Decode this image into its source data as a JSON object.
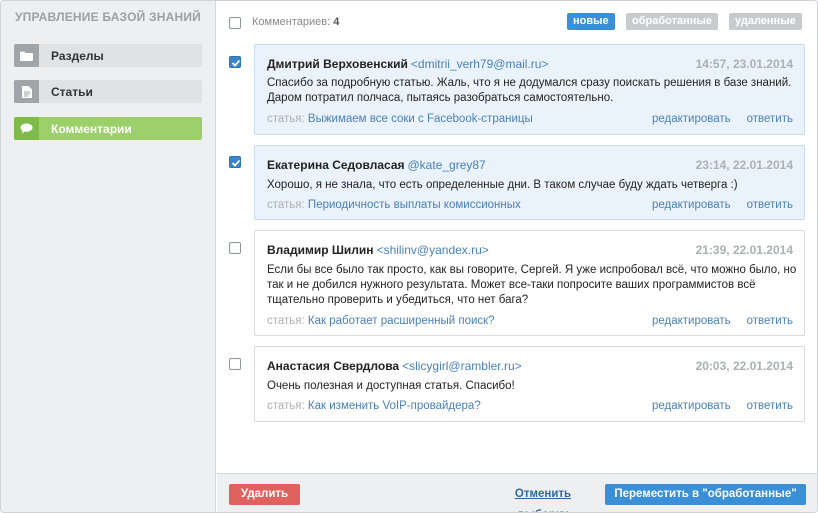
{
  "sidebar": {
    "title": "УПРАВЛЕНИЕ БАЗОЙ ЗНАНИЙ",
    "items": [
      {
        "label": "Разделы",
        "icon": "folder-icon",
        "active": false
      },
      {
        "label": "Статьи",
        "icon": "document-icon",
        "active": false
      },
      {
        "label": "Комментарии",
        "icon": "speech-bubble-icon",
        "active": true
      }
    ]
  },
  "header": {
    "count_label": "Комментариев:",
    "count_value": "4",
    "filters": {
      "new": "новые",
      "processed": "обработанные",
      "deleted": "удаленные"
    }
  },
  "comments": [
    {
      "selected": true,
      "author": "Дмитрий Верховенский",
      "email": "<dmitrii_verh79@mail.ru>",
      "date": "14:57, 23.01.2014",
      "text": "Спасибо за подробную статью. Жаль, что я не додумался сразу поискать решения в базе знаний. Даром потратил полчаса, пытаясь разобраться самостоятельно.",
      "article_prefix": "статья:",
      "article": "Выжимаем все соки с Facebook-страницы",
      "edit": "редактировать",
      "reply": "ответить"
    },
    {
      "selected": true,
      "author": "Екатерина Седовласая",
      "email": "@kate_grey87",
      "date": "23:14, 22.01.2014",
      "text": "Хорошо, я не знала, что есть определенные дни. В таком случае буду ждать четверга :)",
      "article_prefix": "статья:",
      "article": "Периодичность выплаты комиссионных",
      "edit": "редактировать",
      "reply": "ответить"
    },
    {
      "selected": false,
      "author": "Владимир Шилин",
      "email": "<shilinv@yandex.ru>",
      "date": "21:39, 22.01.2014",
      "text": "Если бы все было так просто, как вы говорите, Сергей. Я уже испробовал всё, что можно было, но так и не добился нужного результата. Может все-таки попросите ваших программистов всё тщательно проверить и убедиться, что нет бага?",
      "article_prefix": "статья:",
      "article": "Как работает расширенный поиск?",
      "edit": "редактировать",
      "reply": "ответить"
    },
    {
      "selected": false,
      "author": "Анастасия Свердлова",
      "email": "<slicygirl@rambler.ru>",
      "date": "20:03, 22.01.2014",
      "text": "Очень полезная и доступная статья. Спасибо!",
      "article_prefix": "статья:",
      "article": "Как изменить VoIP-провайдера?",
      "edit": "редактировать",
      "reply": "ответить"
    }
  ],
  "footer": {
    "delete": "Удалить",
    "reset": "Отменить выборку",
    "move": "Переместить в \"обработанные\""
  },
  "colors": {
    "accent": "#3b8fd6",
    "active_nav": "#9bd06a",
    "danger": "#e0625e",
    "selected_row": "#eaf3fb"
  }
}
